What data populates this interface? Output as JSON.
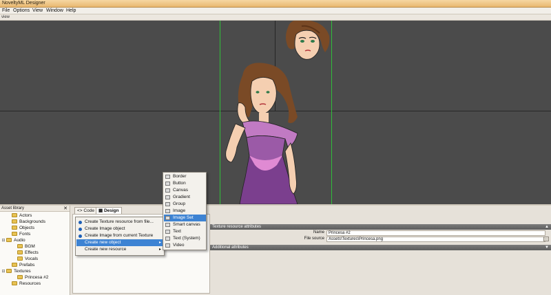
{
  "app": {
    "title": "NoveltyML Designer"
  },
  "menu": [
    "File",
    "Options",
    "View",
    "Window",
    "Help"
  ],
  "view_label": "view",
  "asset_library": {
    "title": "Asset library",
    "close": "✕",
    "items": [
      {
        "label": "Actors",
        "depth": 1,
        "expander": ""
      },
      {
        "label": "Backgrounds",
        "depth": 1,
        "expander": ""
      },
      {
        "label": "Objects",
        "depth": 1,
        "expander": ""
      },
      {
        "label": "Fonts",
        "depth": 1,
        "expander": ""
      },
      {
        "label": "Audio",
        "depth": 0,
        "expander": "⊟"
      },
      {
        "label": "BGM",
        "depth": 2,
        "expander": ""
      },
      {
        "label": "Effects",
        "depth": 2,
        "expander": ""
      },
      {
        "label": "Vocals",
        "depth": 2,
        "expander": ""
      },
      {
        "label": "Prefabs",
        "depth": 1,
        "expander": ""
      },
      {
        "label": "Textures",
        "depth": 0,
        "expander": "⊟"
      },
      {
        "label": "Princesa #2",
        "depth": 2,
        "expander": ""
      },
      {
        "label": "Resources",
        "depth": 1,
        "expander": ""
      }
    ]
  },
  "tabs": {
    "code": "Code",
    "design": "Design"
  },
  "context_menu": {
    "items": [
      {
        "label": "Create Texture resource from file...",
        "has_sub": false
      },
      {
        "label": "Create Image object",
        "has_sub": false
      },
      {
        "label": "Create Image from current Texture",
        "has_sub": false
      },
      {
        "label": "Create new object",
        "has_sub": true
      },
      {
        "label": "Create new resource",
        "has_sub": true
      }
    ],
    "selected_index": 3
  },
  "submenu": {
    "items": [
      "Border",
      "Button",
      "Canvas",
      "Gradient",
      "Group",
      "Image",
      "Image Set",
      "Smart canvas",
      "Text",
      "Text (System)",
      "Video"
    ],
    "selected_index": 6
  },
  "properties": {
    "texture_header": "Texture resource attributes",
    "name_label": "Name",
    "name_value": "Princesa #2",
    "file_label": "File source",
    "file_value": "Assets\\Textures\\Princesa.png",
    "additional_header": "Additional attributes"
  },
  "colors": {
    "canvas": "#4b4b4b",
    "guide": "#2fbf3a",
    "selection": "#3d83d3"
  }
}
